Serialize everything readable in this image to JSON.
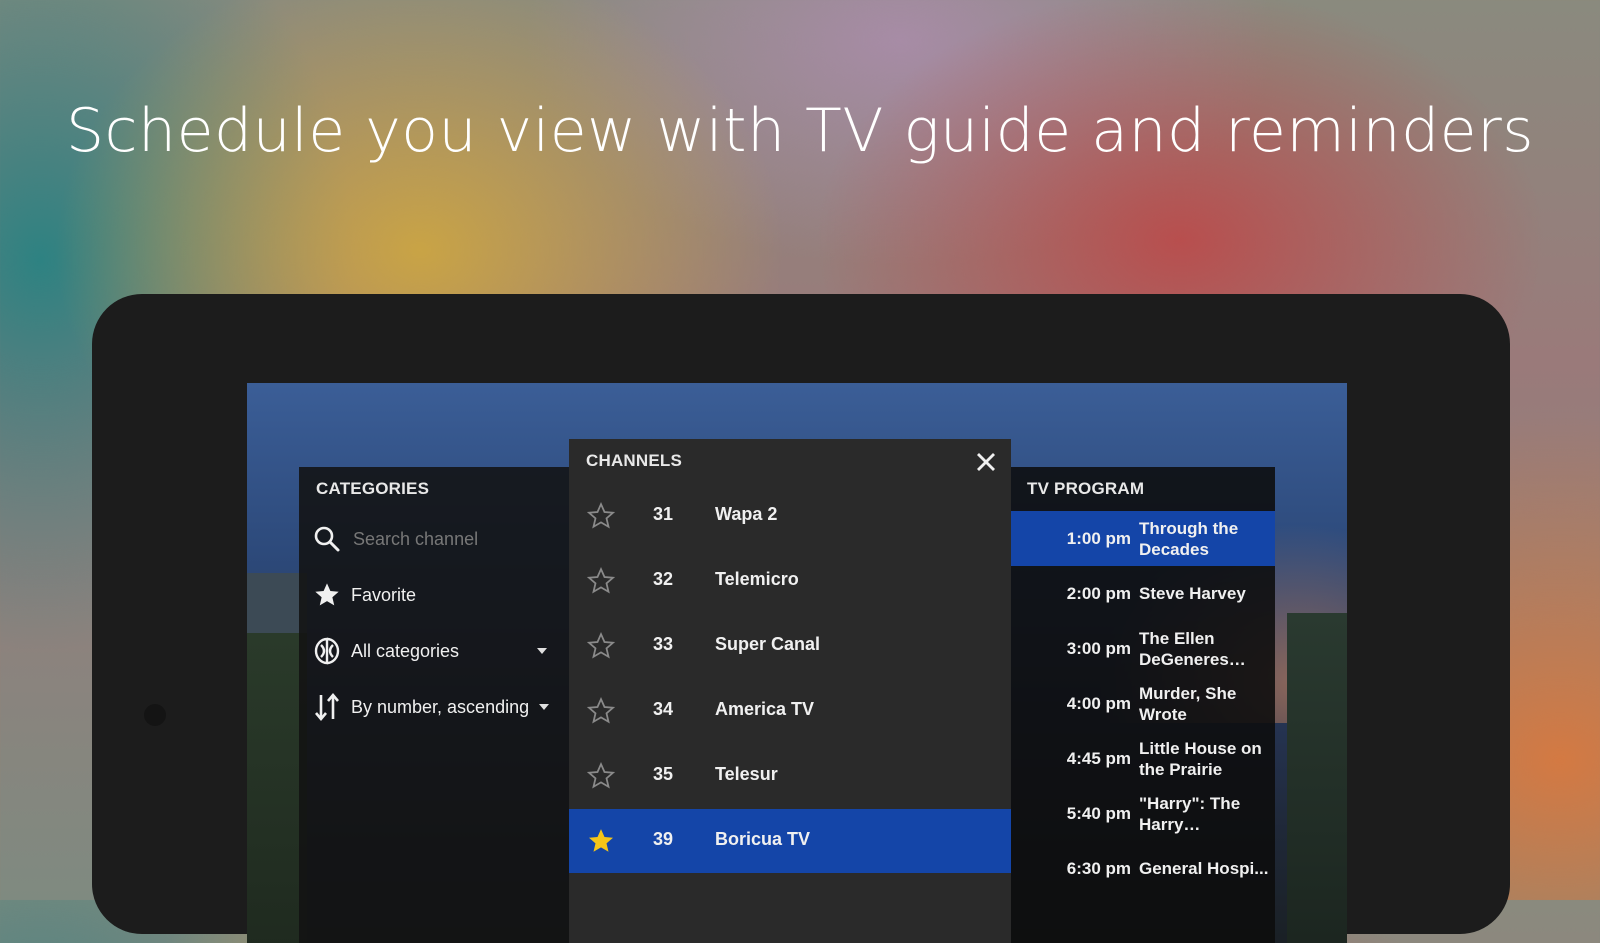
{
  "headline": "Schedule you view with TV guide and reminders",
  "categories": {
    "title": "CATEGORIES",
    "search_placeholder": "Search channel",
    "favorite_label": "Favorite",
    "all_categories_label": "All categories",
    "sort_label": "By number, ascending"
  },
  "channels": {
    "title": "CHANNELS",
    "items": [
      {
        "number": "31",
        "name": "Wapa 2",
        "favorite": false
      },
      {
        "number": "32",
        "name": "Telemicro",
        "favorite": false
      },
      {
        "number": "33",
        "name": "Super Canal",
        "favorite": false
      },
      {
        "number": "34",
        "name": "America TV",
        "favorite": false
      },
      {
        "number": "35",
        "name": "Telesur",
        "favorite": false
      },
      {
        "number": "39",
        "name": "Boricua TV",
        "favorite": true
      }
    ]
  },
  "tv_program": {
    "title": "TV PROGRAM",
    "items": [
      {
        "time": "1:00 pm",
        "title": "Through the Decades"
      },
      {
        "time": "2:00 pm",
        "title": "Steve Harvey"
      },
      {
        "time": "3:00 pm",
        "title": "The Ellen DeGeneres Sh..."
      },
      {
        "time": "4:00 pm",
        "title": "Murder, She Wrote"
      },
      {
        "time": "4:45 pm",
        "title": "Little House on the Prairie"
      },
      {
        "time": "5:40 pm",
        "title": "\"Harry\": The Harry Connick..."
      },
      {
        "time": "6:30 pm",
        "title": "General Hospi..."
      }
    ]
  },
  "colors": {
    "selection": "#1445a8",
    "star_active": "#f5c518",
    "panel_bg": "#2a2a2a"
  },
  "icons": [
    "search-icon",
    "star-icon",
    "categories-icon",
    "sort-icon",
    "close-icon",
    "star-outline-icon",
    "star-filled-icon"
  ]
}
